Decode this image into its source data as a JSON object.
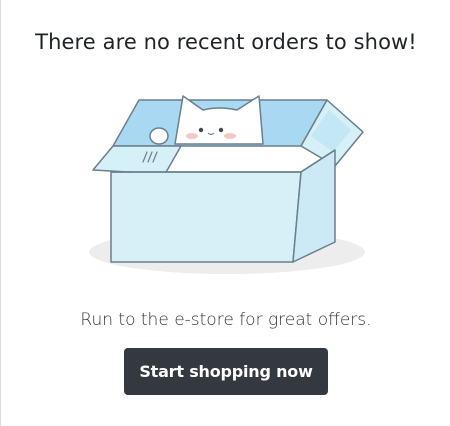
{
  "empty_state": {
    "title": "There are no recent orders to show!",
    "message": "Run to the e-store for great offers.",
    "cta_label": "Start shopping now",
    "illustration_icon": "cat-in-box-icon"
  },
  "colors": {
    "button_background": "#34393f",
    "button_text": "#ffffff",
    "box_fill": "#d6f0f8",
    "box_inner": "#a9d9f2",
    "box_stroke": "#6b7f8c",
    "shadow": "#ededed",
    "text": "#1f2428"
  }
}
